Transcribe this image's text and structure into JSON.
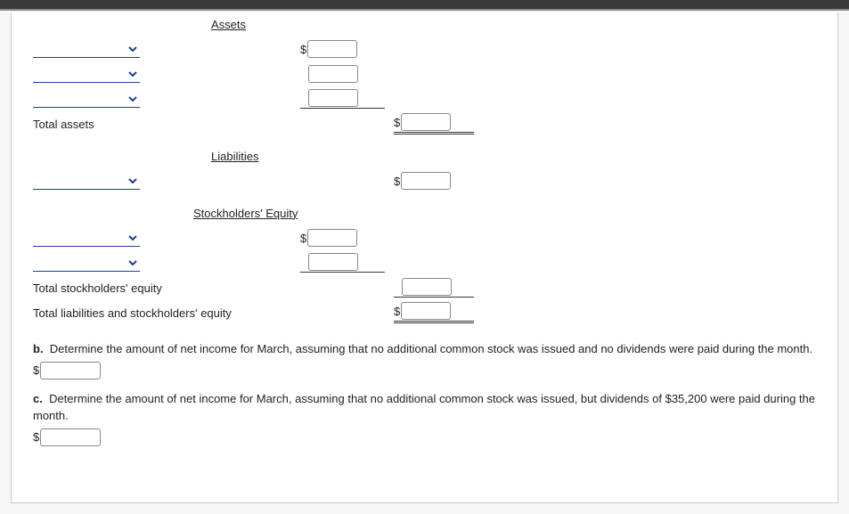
{
  "sections": {
    "assets": "Assets",
    "liabilities": "Liabilities",
    "equity": "Stockholders' Equity"
  },
  "labels": {
    "total_assets": "Total assets",
    "total_equity": "Total stockholders' equity",
    "total_liab_equity": "Total liabilities and stockholders' equity"
  },
  "currency": "$",
  "questions": {
    "b_prefix": "b.",
    "b_text": "Determine the amount of net income for March, assuming that no additional common stock was issued and no dividends were paid during the month.",
    "c_prefix": "c.",
    "c_text": "Determine the amount of net income for March, assuming that no additional common stock was issued, but dividends of $35,200 were paid during the month."
  }
}
